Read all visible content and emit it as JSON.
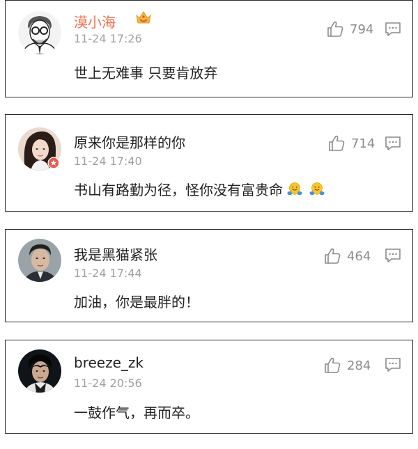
{
  "comments": [
    {
      "username": "漠小海",
      "vip": true,
      "timestamp": "11-24 17:26",
      "text": "世上无难事 只要肯放弃",
      "likes": "794",
      "avatar_icon": "sketch-portrait-glasses",
      "badge_icon": "vip-crown-icon"
    },
    {
      "username": "原来你是那样的你",
      "vip": false,
      "timestamp": "11-24 17:40",
      "text": "书山有路勤为径，怪你没有富贵命",
      "emoji_icon": "hugging-face-emoji",
      "likes": "714",
      "avatar_icon": "woman-portrait",
      "badge_icon": "verified-badge-icon"
    },
    {
      "username": "我是黑猫紧张",
      "vip": false,
      "timestamp": "11-24 17:44",
      "text": "加油，你是最胖的！",
      "likes": "464",
      "avatar_icon": "man-portrait"
    },
    {
      "username": "breeze_zk",
      "vip": false,
      "timestamp": "11-24 20:56",
      "text": "一鼓作气，再而卒。",
      "likes": "284",
      "avatar_icon": "man-dark-portrait"
    }
  ],
  "colors": {
    "vip_name": "#eb7350",
    "text": "#222222",
    "meta": "#a0a0a0",
    "icon": "#8a8a8a"
  }
}
